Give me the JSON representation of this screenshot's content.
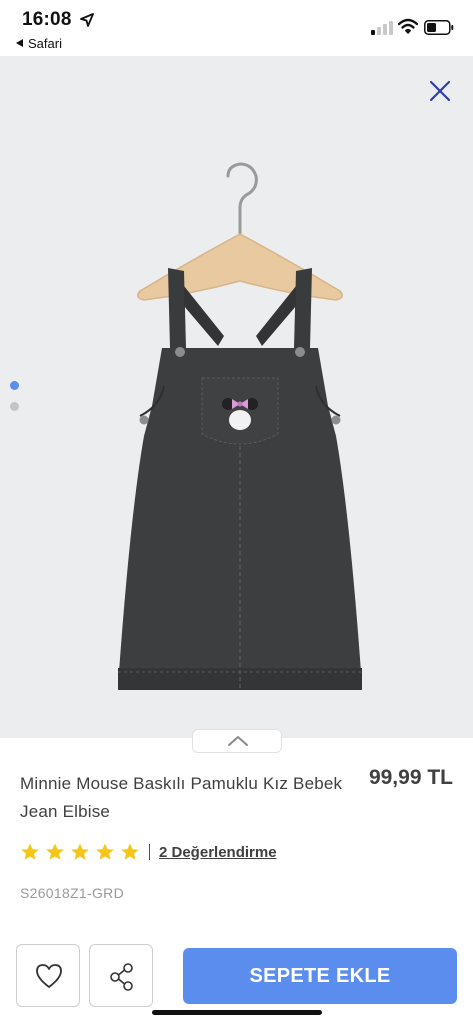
{
  "status_bar": {
    "time": "16:08",
    "back_app": "Safari",
    "icons": [
      "location-arrow-icon",
      "cellular-signal-icon",
      "wifi-icon",
      "battery-icon"
    ]
  },
  "gallery": {
    "close_icon": "close-icon",
    "image_count": 2,
    "active_index": 0,
    "colors": {
      "background": "#ecedee",
      "active_dot": "#5b8def",
      "inactive_dot": "#c4c4c4",
      "close": "#2f3fa8"
    },
    "expand_icon": "chevron-up-icon"
  },
  "product": {
    "title": "Minnie Mouse Baskılı Pamuklu Kız Bebek Jean Elbise",
    "price": "99,99 TL",
    "rating": {
      "stars": 5,
      "max": 5,
      "star_color": "#f5c518"
    },
    "reviews_link": "2 Değerlendirme",
    "sku": "S26018Z1-GRD"
  },
  "actions": {
    "favorite_icon": "heart-icon",
    "share_icon": "share-icon",
    "add_to_cart": "SEPETE EKLE",
    "accent_color": "#5b8def"
  }
}
